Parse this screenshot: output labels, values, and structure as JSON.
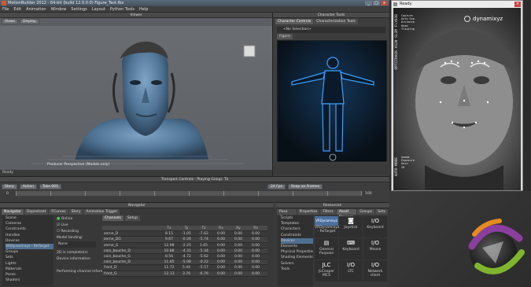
{
  "window": {
    "title": "MotionBuilder 2012 - 64-bit (build 12.0.0.0) Figure_Test.fbx",
    "buttons": [
      "_",
      "□",
      "x"
    ]
  },
  "menu": [
    "File",
    "Edit",
    "Animation",
    "Window",
    "Settings",
    "Layout",
    "Python Tools",
    "Help"
  ],
  "viewer": {
    "header": "Viewer",
    "tools": [
      "Views",
      "Display"
    ],
    "camera_label": "Producer Perspective (Models only)",
    "status": "Ready"
  },
  "character_tools": {
    "header": "Character Tools",
    "tabs": [
      "Character Controls",
      "Characterization Tools"
    ],
    "selection": "<No Selection>",
    "subtab": "Figure"
  },
  "transport": {
    "header": "Transport Controls - Playing Group: Tk",
    "mode": "Story",
    "action": "Action",
    "take": "Take 001",
    "fps": "24 Fps",
    "snap": "Snap on Frames",
    "timeline_start": "0",
    "timeline_end": "100"
  },
  "navigator": {
    "header": "Navigator",
    "tabs": [
      "Navigator",
      "Dopesheet",
      "FCurves",
      "Story",
      "Animation Trigger"
    ],
    "tree": [
      "Scene",
      "Cameras",
      "Constraints",
      "Handles",
      "Devices",
      "VRDynamixyz - ReTarget",
      "Groups",
      "Sets",
      "Lights",
      "Materials",
      "Poses",
      "Shaders",
      "Takes",
      "Textures"
    ],
    "options": [
      "Online",
      "Live",
      "Recording"
    ],
    "model_binding_label": "Model binding:",
    "model_binding_value": "None",
    "fields": [
      "2D is complete(s)",
      "Device information",
      "Performing channel information"
    ],
    "channels_header": "Channels",
    "channel_sub": "Setup",
    "columns": [
      "Tx",
      "Ty",
      "Tz",
      "Rx",
      "Ry",
      "Rz"
    ],
    "rows": [
      {
        "name": "zerne_D",
        "values": [
          "8.15",
          "-1.05",
          "-7.62",
          "0.00",
          "0.00",
          "0.00"
        ]
      },
      {
        "name": "zerne_DG",
        "values": [
          "9.67",
          "-0.26",
          "-5.74",
          "0.00",
          "0.00",
          "0.00"
        ]
      },
      {
        "name": "zerne_G",
        "values": [
          "12.08",
          "-2.25",
          "1.65",
          "0.00",
          "0.00",
          "0.00"
        ]
      },
      {
        "name": "coin_bouche_D",
        "values": [
          "10.88",
          "-4.31",
          "-5.34",
          "0.00",
          "0.00",
          "0.00"
        ]
      },
      {
        "name": "coin_bouche_G",
        "values": [
          "8.56",
          "-4.72",
          "-5.62",
          "0.00",
          "0.00",
          "0.00"
        ]
      },
      {
        "name": "coin_bouche_D",
        "values": [
          "11.85",
          "-5.08",
          "-0.22",
          "0.00",
          "0.00",
          "0.00"
        ]
      },
      {
        "name": "front_D",
        "values": [
          "11.72",
          "5.44",
          "-5.57",
          "0.00",
          "0.00",
          "0.00"
        ]
      },
      {
        "name": "front_G",
        "values": [
          "12.13",
          "3.76",
          "-6.76",
          "0.00",
          "0.00",
          "0.00"
        ]
      }
    ]
  },
  "resources": {
    "header": "Resources",
    "tabs": [
      "Pose Controls",
      "Properties",
      "Filters",
      "Asset Browser",
      "Groups",
      "Sets"
    ],
    "tree": [
      "Scripts",
      "Templates",
      "Characters",
      "Constraints",
      "Devices",
      "Elements",
      "Physical Properties",
      "Shading Elements",
      "Solvers",
      "Tools"
    ],
    "devices": [
      {
        "label": "VRDynamixyz",
        "caption": "VRDynamixyz - ReTarget"
      },
      {
        "label": "",
        "caption": "Joystick"
      },
      {
        "label": "I/O",
        "caption": "Keyboard"
      },
      {
        "label": "",
        "caption": "General Purpose"
      },
      {
        "label": "",
        "caption": "Keyboard"
      },
      {
        "label": "I/O",
        "caption": "Mouse"
      },
      {
        "label": "JLC",
        "caption": "JLCooper MCS"
      },
      {
        "label": "I/O",
        "caption": "LTC"
      },
      {
        "label": "I/O",
        "caption": "Network client"
      }
    ]
  },
  "camera": {
    "title": "Ready",
    "brand": "dynamixyz",
    "left_text": "OPTITRACK V120 SLIM FLY010",
    "right_text": "AUTO MODE",
    "top_lines": [
      "Capture",
      "Auto Exp",
      "Distance",
      "Head",
      "Tracking"
    ],
    "bottom_lines": [
      "Gamma",
      "Exposure",
      "Gain",
      "IR"
    ]
  },
  "colors": {
    "accent": "#6fa8dc",
    "figure_glow": "#3aa0ff",
    "skin": "#5a7fa0",
    "logo_purple": "#8a3f9f",
    "logo_green": "#7fb52e",
    "logo_orange": "#e58b1f"
  }
}
